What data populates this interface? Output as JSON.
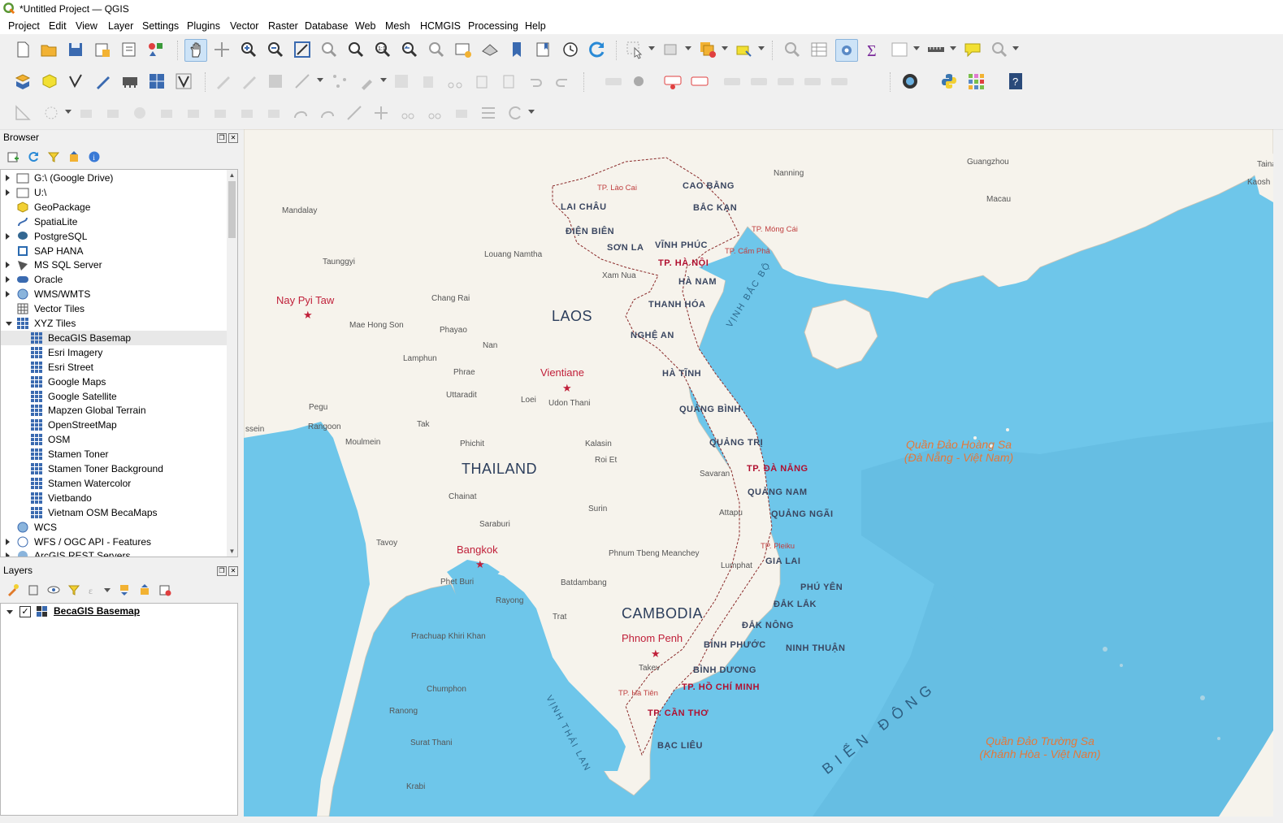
{
  "window": {
    "title": "*Untitled Project — QGIS"
  },
  "menu": [
    "Project",
    "Edit",
    "View",
    "Layer",
    "Settings",
    "Plugins",
    "Vector",
    "Raster",
    "Database",
    "Web",
    "Mesh",
    "HCMGIS",
    "Processing",
    "Help"
  ],
  "browser": {
    "title": "Browser",
    "items": [
      {
        "label": "G:\\ (Google Drive)",
        "icon": "folder-icon",
        "expander": "collapsed"
      },
      {
        "label": "U:\\",
        "icon": "folder-icon",
        "expander": "collapsed"
      },
      {
        "label": "GeoPackage",
        "icon": "geopackage-icon",
        "expander": ""
      },
      {
        "label": "SpatiaLite",
        "icon": "spatialite-icon",
        "expander": ""
      },
      {
        "label": "PostgreSQL",
        "icon": "postgresql-icon",
        "expander": "collapsed"
      },
      {
        "label": "SAP HANA",
        "icon": "sap-hana-icon",
        "expander": ""
      },
      {
        "label": "MS SQL Server",
        "icon": "mssql-icon",
        "expander": "collapsed"
      },
      {
        "label": "Oracle",
        "icon": "oracle-icon",
        "expander": "collapsed"
      },
      {
        "label": "WMS/WMTS",
        "icon": "wms-icon",
        "expander": "collapsed"
      },
      {
        "label": "Vector Tiles",
        "icon": "vector-tiles-icon",
        "expander": ""
      },
      {
        "label": "XYZ Tiles",
        "icon": "xyz-tiles-icon",
        "expander": "expanded"
      },
      {
        "label": "BecaGIS Basemap",
        "icon": "xyz-tiles-icon",
        "expander": "",
        "child": true,
        "selected": true
      },
      {
        "label": "Esri Imagery",
        "icon": "xyz-tiles-icon",
        "expander": "",
        "child": true
      },
      {
        "label": "Esri Street",
        "icon": "xyz-tiles-icon",
        "expander": "",
        "child": true
      },
      {
        "label": "Google Maps",
        "icon": "xyz-tiles-icon",
        "expander": "",
        "child": true
      },
      {
        "label": "Google Satellite",
        "icon": "xyz-tiles-icon",
        "expander": "",
        "child": true
      },
      {
        "label": "Mapzen Global Terrain",
        "icon": "xyz-tiles-icon",
        "expander": "",
        "child": true
      },
      {
        "label": "OpenStreetMap",
        "icon": "xyz-tiles-icon",
        "expander": "",
        "child": true
      },
      {
        "label": "OSM",
        "icon": "xyz-tiles-icon",
        "expander": "",
        "child": true
      },
      {
        "label": "Stamen Toner",
        "icon": "xyz-tiles-icon",
        "expander": "",
        "child": true
      },
      {
        "label": "Stamen Toner Background",
        "icon": "xyz-tiles-icon",
        "expander": "",
        "child": true
      },
      {
        "label": "Stamen Watercolor",
        "icon": "xyz-tiles-icon",
        "expander": "",
        "child": true
      },
      {
        "label": "Vietbando",
        "icon": "xyz-tiles-icon",
        "expander": "",
        "child": true
      },
      {
        "label": "Vietnam OSM BecaMaps",
        "icon": "xyz-tiles-icon",
        "expander": "",
        "child": true
      },
      {
        "label": "WCS",
        "icon": "wcs-icon",
        "expander": ""
      },
      {
        "label": "WFS / OGC API - Features",
        "icon": "wfs-icon",
        "expander": "collapsed"
      },
      {
        "label": "ArcGIS REST Servers",
        "icon": "arcgis-icon",
        "expander": "collapsed"
      }
    ]
  },
  "layers": {
    "title": "Layers",
    "items": [
      {
        "label": "BecaGIS Basemap",
        "checked": true
      }
    ]
  },
  "map": {
    "countries": [
      "LAOS",
      "THAILAND",
      "CAMBODIA"
    ],
    "capitals": [
      "Nay Pyi Taw",
      "Vientiane",
      "Bangkok",
      "Phnom Penh"
    ],
    "cities": [
      "Mandalay",
      "Taunggyi",
      "Mae Hong Son",
      "Chang Rai",
      "Phayao",
      "Lamphun",
      "Nan",
      "Phrae",
      "Uttaradit",
      "Loei",
      "Udon Thani",
      "Pegu",
      "Rangoon",
      "ssein",
      "Moulmein",
      "Tak",
      "Phichit",
      "Kalasin",
      "Roi Et",
      "Chainat",
      "Saraburi",
      "Surin",
      "Savaran",
      "Attapu",
      "Tavoy",
      "Phet Buri",
      "Rayong",
      "Trat",
      "Batdambang",
      "Phnum Tbeng Meanchey",
      "Lumphat",
      "Prachuap Khiri Khan",
      "Chumphon",
      "Ranong",
      "Surat Thani",
      "Krabi",
      "Takev",
      "Nanning",
      "Guangzhou",
      "Macau",
      "Louang Namtha",
      "Xam Nua",
      "Taina",
      "Kaosh"
    ],
    "provinces": [
      "CAO BẰNG",
      "LAI CHÂU",
      "BẮC KẠN",
      "ĐIỆN BIÊN",
      "SƠN LA",
      "VĨNH PHÚC",
      "HÀ NAM",
      "THANH HÓA",
      "NGHỆ AN",
      "HÀ TĨNH",
      "QUẢNG BÌNH",
      "QUẢNG TRỊ",
      "QUẢNG NAM",
      "QUẢNG NGÃI",
      "GIA LAI",
      "PHÚ YÊN",
      "ĐẮK LẮK",
      "ĐẮK NÔNG",
      "BÌNH PHƯỚC",
      "NINH THUẬN",
      "BÌNH DƯƠNG",
      "BẠC LIÊU"
    ],
    "major_cities": [
      "TP. HÀ NỘI",
      "TP. ĐÀ NẴNG",
      "TP. HỒ CHÍ MINH",
      "TP. CẦN THƠ"
    ],
    "towns": [
      "TP. Lào Cai",
      "TP. Móng Cái",
      "TP. Cẩm Phả",
      "TP. Pleiku",
      "TP. Hà Tiên"
    ],
    "bays": [
      "VỊNH BẮC BỘ",
      "VỊNH THÁI LAN"
    ],
    "sea": "BIỂN ĐÔNG",
    "islands": [
      {
        "line1": "Quần Đảo Hoàng Sa",
        "line2": "(Đà Nẵng - Việt Nam)"
      },
      {
        "line1": "Quần Đảo Trường Sa",
        "line2": "(Khánh Hòa - Việt Nam)"
      }
    ],
    "colors": {
      "sea": "#6ec6ea",
      "land": "#f6f3ec",
      "accent": "#c0203a"
    }
  }
}
